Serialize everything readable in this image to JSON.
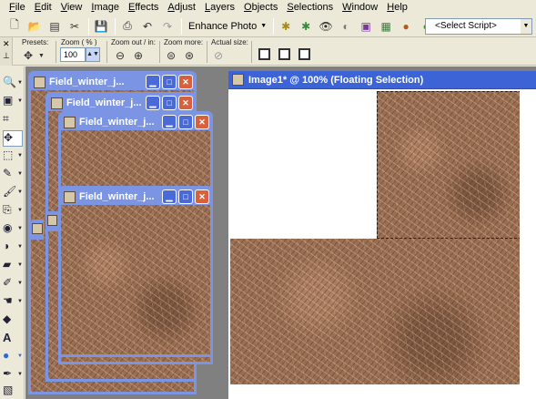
{
  "menu": [
    "File",
    "Edit",
    "View",
    "Image",
    "Effects",
    "Adjust",
    "Layers",
    "Objects",
    "Selections",
    "Window",
    "Help"
  ],
  "toolbar": {
    "enhance_label": "Enhance Photo",
    "script_placeholder": "<Select Script>"
  },
  "tool_options": {
    "presets_label": "Presets:",
    "zoom_pct_label": "Zoom ( % )",
    "zoom_value": "100",
    "zoom_out_in_label": "Zoom out / in:",
    "zoom_more_label": "Zoom more:",
    "actual_size_label": "Actual size:"
  },
  "child_windows": [
    {
      "title": "Field_winter_j..."
    },
    {
      "title": "Field_winter_j..."
    },
    {
      "title": "Field_winter_j..."
    },
    {
      "title": "Field_winter_j..."
    }
  ],
  "main_window": {
    "title": "Image1* @ 100% (Floating Selection)"
  },
  "colors": {
    "title_active": "#3c64d6",
    "title_inactive": "#7b95e4",
    "close_button": "#d8603c",
    "workspace": "#808080"
  }
}
